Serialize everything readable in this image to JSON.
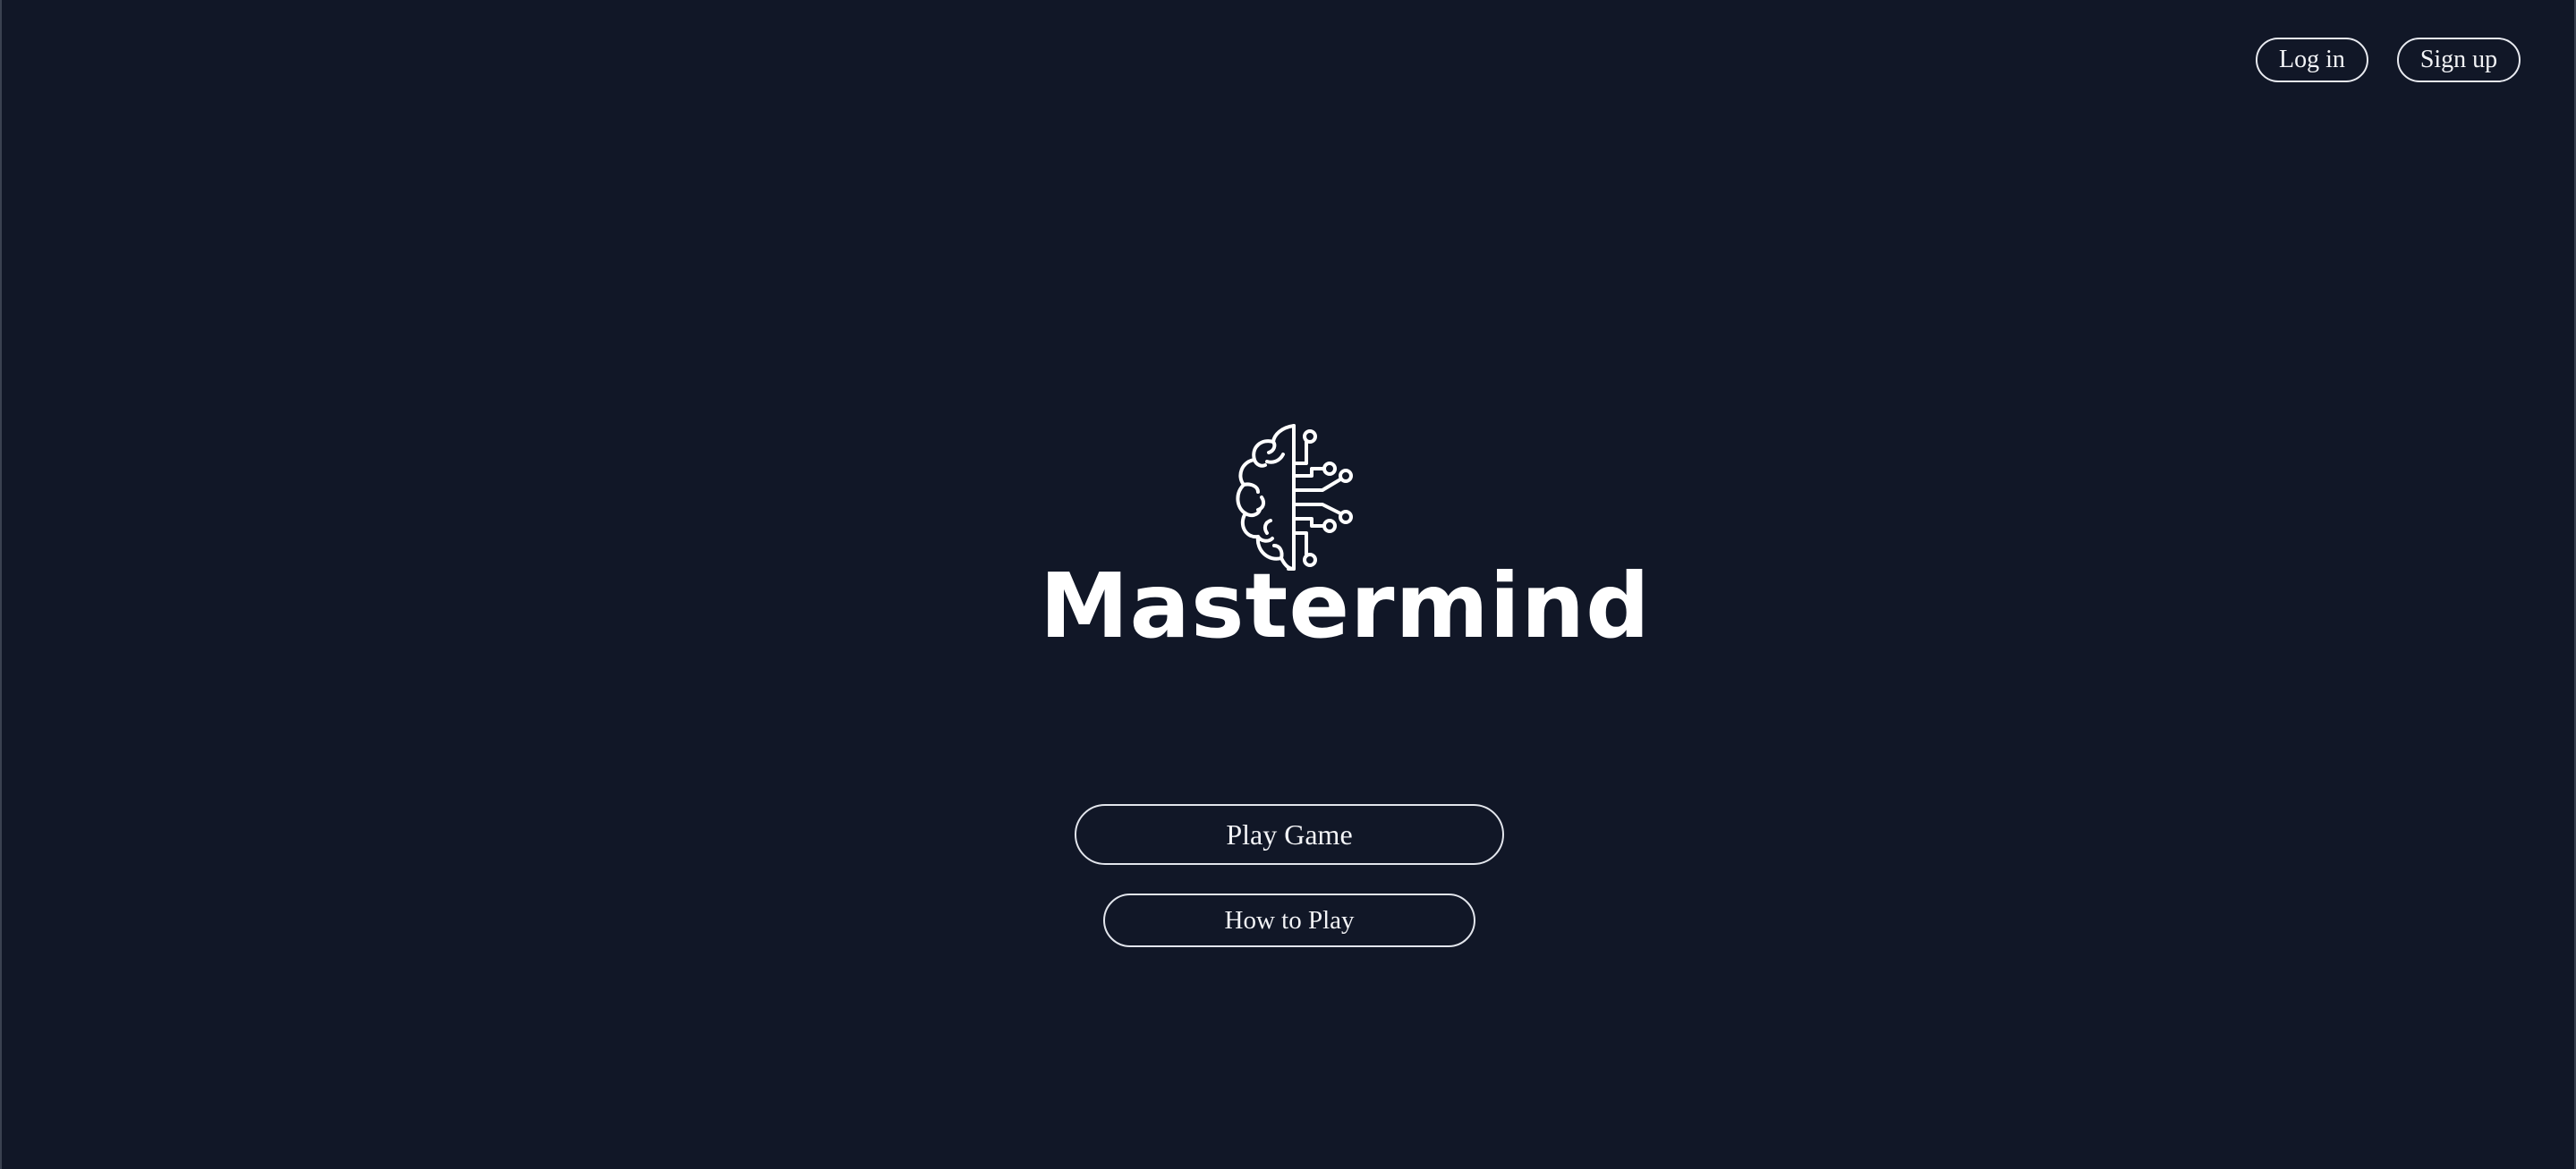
{
  "header": {
    "login_label": "Log in",
    "signup_label": "Sign up"
  },
  "hero": {
    "logo_icon": "brain-circuit-icon",
    "title": "Mastermind"
  },
  "menu": {
    "play_label": "Play Game",
    "howto_label": "How to Play"
  },
  "colors": {
    "background": "#111727",
    "foreground": "#ffffff",
    "button_border": "#e2e5ec"
  }
}
